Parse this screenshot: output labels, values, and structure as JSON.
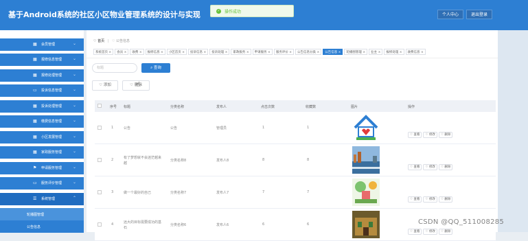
{
  "header": {
    "title": "基于Android系统的社区小区物业管理系统的设计与实现",
    "user_btn": "个人中心",
    "logout_btn": "退出登录"
  },
  "toast": {
    "text": "操作成功"
  },
  "sidebar": {
    "items": [
      {
        "label": "会员管理",
        "icon": "grid-icon"
      },
      {
        "label": "报修信息管理",
        "icon": "grid-icon"
      },
      {
        "label": "报修处理管理",
        "icon": "grid-icon"
      },
      {
        "label": "投诉信息管理",
        "icon": "screen-icon"
      },
      {
        "label": "投诉处理管理",
        "icon": "grid-icon"
      },
      {
        "label": "缴费信息管理",
        "icon": "grid-icon"
      },
      {
        "label": "小区发展管理",
        "icon": "grid-icon"
      },
      {
        "label": "家政服务管理",
        "icon": "grid-icon"
      },
      {
        "label": "申请服务管理",
        "icon": "flag-icon"
      },
      {
        "label": "服务评价管理",
        "icon": "screen-icon"
      },
      {
        "label": "系统管理",
        "icon": "db-icon"
      }
    ],
    "sub_items": [
      {
        "label": "轮播图管理"
      },
      {
        "label": "公告信息"
      }
    ]
  },
  "breadcrumb": {
    "home": "首页",
    "current": "公告信息"
  },
  "tabs": [
    "系统首页",
    "会员",
    "收费",
    "报修信息",
    "小区首页",
    "投诉信息",
    "投诉处理",
    "家政服务",
    "申请服务",
    "服务评价",
    "公告信息分类",
    "公告信息",
    "轮播图管理",
    "业主",
    "报修处理",
    "收费信息"
  ],
  "active_tab": "公告信息",
  "search": {
    "placeholder": "标题",
    "query_btn": "查询"
  },
  "actions": {
    "add_btn": "添加",
    "delete_btn": "删除"
  },
  "table": {
    "headers": [
      "序号",
      "标题",
      "分类名称",
      "发布人",
      "点击次数",
      "收藏数",
      "图片",
      "操作"
    ],
    "rows": [
      {
        "no": "1",
        "title": "公告",
        "category": "公告",
        "author": "管理员",
        "clicks": "1",
        "favs": "1",
        "img": "house-icon"
      },
      {
        "no": "2",
        "title": "有了梦想就不会迷茫越来",
        "title2": "越",
        "category": "分类名称8",
        "author": "发布人8",
        "clicks": "8",
        "favs": "8",
        "img": "city-photo"
      },
      {
        "no": "3",
        "title": "做一个最好的自己",
        "category": "分类名称7",
        "author": "发布人7",
        "clicks": "7",
        "favs": "7",
        "img": "cartoon-photo"
      },
      {
        "no": "4",
        "title": "远大的目标需要成功的基",
        "title2": "石",
        "category": "分类名称6",
        "author": "发布人6",
        "clicks": "6",
        "favs": "6",
        "img": "house-photo"
      }
    ],
    "op_labels": {
      "view": "查看",
      "edit": "修改",
      "delete": "删除"
    }
  },
  "watermark": "CSDN @QQ_511008285"
}
